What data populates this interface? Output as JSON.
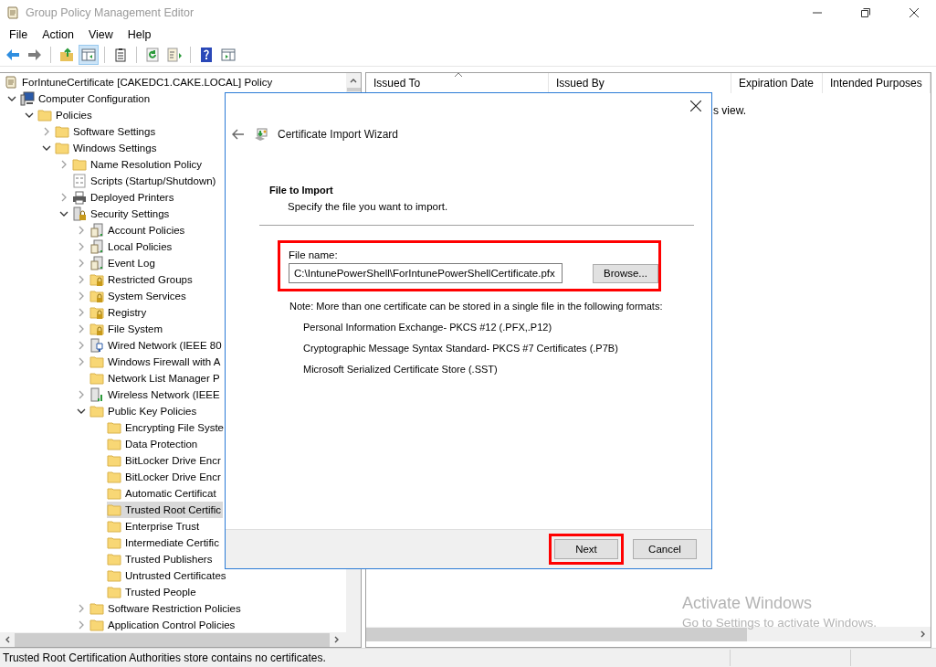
{
  "window": {
    "title": "Group Policy Management Editor"
  },
  "menu": [
    "File",
    "Action",
    "View",
    "Help"
  ],
  "toolbar_groups": [
    {
      "buttons": [
        {
          "kind": "back",
          "pressed": false
        },
        {
          "kind": "forward",
          "pressed": false
        }
      ]
    },
    {
      "buttons": [
        {
          "kind": "up",
          "pressed": false
        },
        {
          "kind": "tree",
          "pressed": true
        }
      ]
    },
    {
      "buttons": [
        {
          "kind": "clipboard",
          "pressed": false
        }
      ]
    },
    {
      "buttons": [
        {
          "kind": "refresh",
          "pressed": false
        },
        {
          "kind": "export",
          "pressed": false
        }
      ]
    },
    {
      "buttons": [
        {
          "kind": "help",
          "pressed": false
        },
        {
          "kind": "pane",
          "pressed": false
        }
      ]
    }
  ],
  "tree": [
    {
      "label": "ForIntuneCertificate [CAKEDC1.CAKE.LOCAL] Policy",
      "kind": "policy",
      "expandable": false,
      "selected": false,
      "children": [
        {
          "label": "Computer Configuration",
          "kind": "computer",
          "expandable": true,
          "expanded": true,
          "selected": false,
          "children": [
            {
              "label": "Policies",
              "kind": "folder",
              "expandable": true,
              "expanded": true,
              "selected": false,
              "children": [
                {
                  "label": "Software Settings",
                  "kind": "folder",
                  "expandable": true,
                  "expanded": false,
                  "selected": false
                },
                {
                  "label": "Windows Settings",
                  "kind": "folder",
                  "expandable": true,
                  "expanded": true,
                  "selected": false,
                  "children": [
                    {
                      "label": "Name Resolution Policy",
                      "kind": "folder",
                      "expandable": true,
                      "expanded": false,
                      "selected": false
                    },
                    {
                      "label": "Scripts (Startup/Shutdown)",
                      "kind": "script",
                      "expandable": false,
                      "selected": false
                    },
                    {
                      "label": "Deployed Printers",
                      "kind": "printer",
                      "expandable": true,
                      "expanded": false,
                      "selected": false
                    },
                    {
                      "label": "Security Settings",
                      "kind": "security",
                      "expandable": true,
                      "expanded": true,
                      "selected": false,
                      "children": [
                        {
                          "label": "Account Policies",
                          "kind": "server",
                          "expandable": true,
                          "expanded": false,
                          "selected": false
                        },
                        {
                          "label": "Local Policies",
                          "kind": "server",
                          "expandable": true,
                          "expanded": false,
                          "selected": false
                        },
                        {
                          "label": "Event Log",
                          "kind": "server",
                          "expandable": true,
                          "expanded": false,
                          "selected": false
                        },
                        {
                          "label": "Restricted Groups",
                          "kind": "lock-folder",
                          "expandable": true,
                          "expanded": false,
                          "selected": false
                        },
                        {
                          "label": "System Services",
                          "kind": "lock-folder",
                          "expandable": true,
                          "expanded": false,
                          "selected": false
                        },
                        {
                          "label": "Registry",
                          "kind": "lock-folder",
                          "expandable": true,
                          "expanded": false,
                          "selected": false
                        },
                        {
                          "label": "File System",
                          "kind": "lock-folder",
                          "expandable": true,
                          "expanded": false,
                          "selected": false
                        },
                        {
                          "label": "Wired Network (IEEE 80",
                          "kind": "network",
                          "expandable": true,
                          "expanded": false,
                          "selected": false
                        },
                        {
                          "label": "Windows Firewall with A",
                          "kind": "folder",
                          "expandable": true,
                          "expanded": false,
                          "selected": false
                        },
                        {
                          "label": "Network List Manager P",
                          "kind": "folder",
                          "expandable": false,
                          "selected": false
                        },
                        {
                          "label": "Wireless Network (IEEE",
                          "kind": "wireless",
                          "expandable": true,
                          "expanded": false,
                          "selected": false
                        },
                        {
                          "label": "Public Key Policies",
                          "kind": "folder",
                          "expandable": true,
                          "expanded": true,
                          "selected": false,
                          "children": [
                            {
                              "label": "Encrypting File Syste",
                              "kind": "folder",
                              "expandable": false,
                              "selected": false
                            },
                            {
                              "label": "Data Protection",
                              "kind": "folder",
                              "expandable": false,
                              "selected": false
                            },
                            {
                              "label": "BitLocker Drive Encr",
                              "kind": "folder",
                              "expandable": false,
                              "selected": false
                            },
                            {
                              "label": "BitLocker Drive Encr",
                              "kind": "folder",
                              "expandable": false,
                              "selected": false
                            },
                            {
                              "label": "Automatic Certificat",
                              "kind": "folder",
                              "expandable": false,
                              "selected": false
                            },
                            {
                              "label": "Trusted Root Certific",
                              "kind": "folder",
                              "expandable": false,
                              "selected": true
                            },
                            {
                              "label": "Enterprise Trust",
                              "kind": "folder",
                              "expandable": false,
                              "selected": false
                            },
                            {
                              "label": "Intermediate Certific",
                              "kind": "folder",
                              "expandable": false,
                              "selected": false
                            },
                            {
                              "label": "Trusted Publishers",
                              "kind": "folder",
                              "expandable": false,
                              "selected": false
                            },
                            {
                              "label": "Untrusted Certificates",
                              "kind": "folder",
                              "expandable": false,
                              "selected": false
                            },
                            {
                              "label": "Trusted People",
                              "kind": "folder",
                              "expandable": false,
                              "selected": false
                            }
                          ]
                        },
                        {
                          "label": "Software Restriction Policies",
                          "kind": "folder",
                          "expandable": true,
                          "expanded": false,
                          "selected": false
                        },
                        {
                          "label": "Application Control Policies",
                          "kind": "folder",
                          "expandable": true,
                          "expanded": false,
                          "selected": false
                        }
                      ]
                    }
                  ]
                }
              ]
            }
          ]
        }
      ]
    }
  ],
  "list": {
    "columns": [
      {
        "label": "Issued To",
        "sorted": true
      },
      {
        "label": "Issued By",
        "sorted": false
      },
      {
        "label": "Expiration Date",
        "sorted": false
      },
      {
        "label": "Intended Purposes",
        "sorted": false
      }
    ],
    "message": "s view."
  },
  "dialog": {
    "title": "Certificate Import Wizard",
    "heading": "File to Import",
    "subheading": "Specify the file you want to import.",
    "file_field": {
      "label": "File name:",
      "value": "C:\\IntunePowerShell\\ForIntunePowerShellCertificate.pfx",
      "highlighted": true
    },
    "browse_button": "Browse...",
    "note": "Note:  More than one certificate can be stored in a single file in the following formats:",
    "formats": [
      "Personal Information Exchange- PKCS #12 (.PFX,.P12)",
      "Cryptographic Message Syntax Standard- PKCS #7 Certificates (.P7B)",
      "Microsoft Serialized Certificate Store (.SST)"
    ],
    "buttons": [
      {
        "label": "Next",
        "highlighted": true
      },
      {
        "label": "Cancel",
        "highlighted": false
      }
    ]
  },
  "status_bar": {
    "text": "Trusted Root Certification Authorities store contains no certificates."
  },
  "activation_notice": {
    "title": "Activate Windows",
    "text": "Go to Settings to activate Windows."
  }
}
